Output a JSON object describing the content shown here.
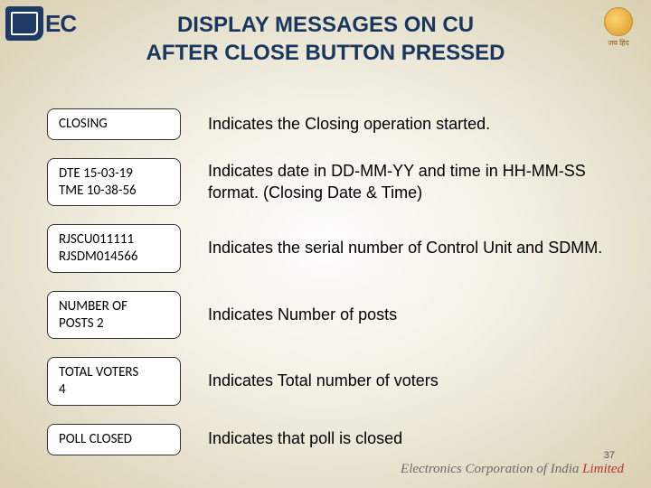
{
  "title_line1": "DISPLAY MESSAGES ON CU",
  "title_line2": "AFTER CLOSE BUTTON PRESSED",
  "logo_left_text": "EC",
  "logo_right_text": "जय हिंद",
  "rows": [
    {
      "box_line1": "CLOSING",
      "box_line2": "",
      "desc": "Indicates the Closing operation started."
    },
    {
      "box_line1": "DTE  15-03-19",
      "box_line2": "TME 10-38-56",
      "desc": "Indicates date in DD-MM-YY and  time in HH-MM-SS format. (Closing Date & Time)"
    },
    {
      "box_line1": "RJSCU011111",
      "box_line2": "RJSDM014566",
      "desc": "Indicates the serial number of Control Unit and SDMM."
    },
    {
      "box_line1": "NUMBER OF",
      "box_line2": "POSTS 2",
      "desc": "Indicates Number of posts"
    },
    {
      "box_line1": "TOTAL VOTERS",
      "box_line2": "4",
      "desc": "Indicates Total number of voters"
    },
    {
      "box_line1": "POLL CLOSED",
      "box_line2": "",
      "desc": "Indicates that poll is closed"
    }
  ],
  "footer_prefix": "Electronics Corporation of India ",
  "footer_suffix": "Limited",
  "page_number": "37"
}
